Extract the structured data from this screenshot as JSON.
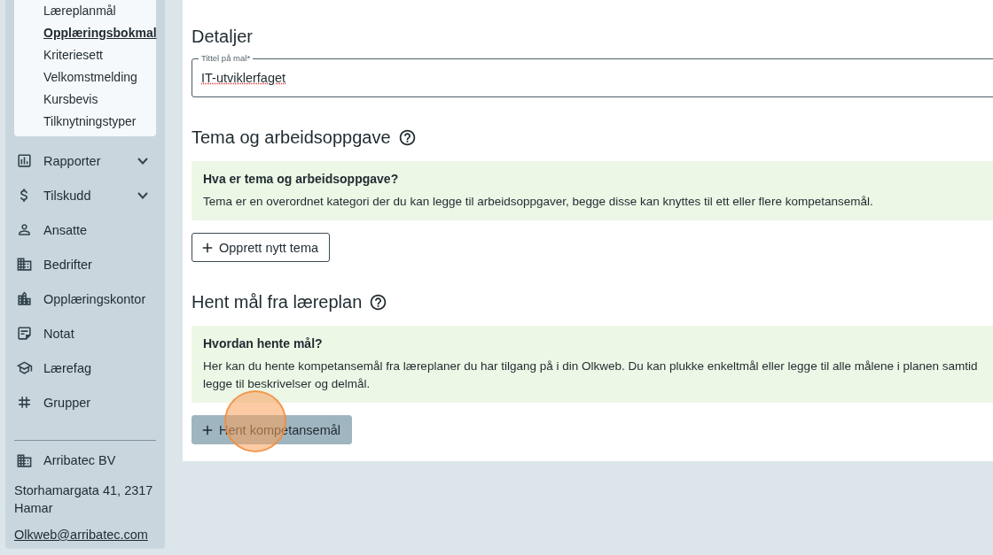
{
  "sidebar": {
    "subitems": [
      {
        "label": "Læreplanmål",
        "selected": false
      },
      {
        "label": "Opplæringsbokmal",
        "selected": true
      },
      {
        "label": "Kriteriesett",
        "selected": false
      },
      {
        "label": "Velkomstmelding",
        "selected": false
      },
      {
        "label": "Kursbevis",
        "selected": false
      },
      {
        "label": "Tilknytningstyper",
        "selected": false
      }
    ],
    "items": [
      {
        "label": "Rapporter",
        "kind": "chart",
        "expandable": true
      },
      {
        "label": "Tilskudd",
        "kind": "dollar",
        "expandable": true
      },
      {
        "label": "Ansatte",
        "kind": "person",
        "expandable": false
      },
      {
        "label": "Bedrifter",
        "kind": "company",
        "expandable": false
      },
      {
        "label": "Opplæringskontor",
        "kind": "office",
        "expandable": false
      },
      {
        "label": "Notat",
        "kind": "note",
        "expandable": false
      },
      {
        "label": "Lærefag",
        "kind": "school",
        "expandable": false
      },
      {
        "label": "Grupper",
        "kind": "hash",
        "expandable": false
      }
    ],
    "footer": {
      "company": "Arribatec BV",
      "address": "Storhamargata 41, 2317 Hamar",
      "email": "Olkweb@arribatec.com"
    }
  },
  "main": {
    "heading": "Detaljer",
    "title_field": {
      "label": "Tittel på mal*",
      "value": "IT-utviklerfaget"
    },
    "sections": [
      {
        "heading": "Tema og arbeidsoppgave",
        "info_title": "Hva er tema og arbeidsoppgave?",
        "info_lines": [
          "Tema er en overordnet kategori der du kan legge til arbeidsoppgaver, begge disse kan knyttes til ett eller flere kompetansemål."
        ],
        "button": {
          "label": "Opprett nytt tema",
          "kind": "outlined"
        }
      },
      {
        "heading": "Hent mål fra læreplan",
        "info_title": "Hvordan hente mål?",
        "info_lines": [
          "Her kan du hente kompetansemål fra læreplaner du har tilgang på i din Olkweb. Du kan plukke enkeltmål eller legge til alle målene i planen samtid",
          "legge til beskrivelser og delmål."
        ],
        "button": {
          "label": "Hent kompetansemål",
          "kind": "filled",
          "click_marker": true
        }
      }
    ]
  }
}
